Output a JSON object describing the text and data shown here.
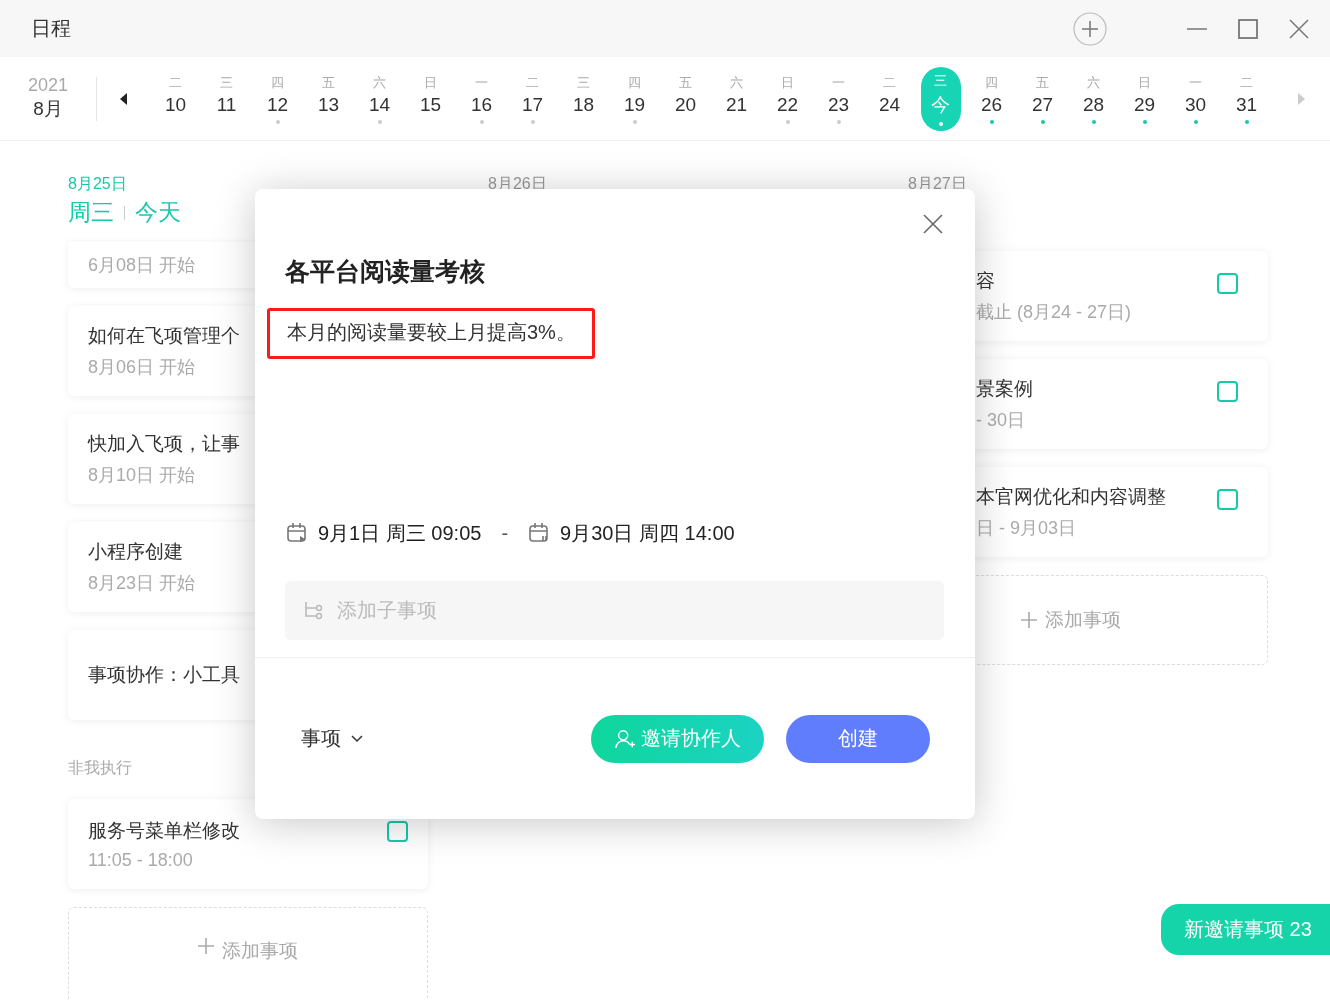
{
  "window": {
    "title": "日程"
  },
  "strip": {
    "year": "2021",
    "month": "8月",
    "days": [
      {
        "weekday": "二",
        "date": "10",
        "selected": false
      },
      {
        "weekday": "三",
        "date": "11",
        "selected": false
      },
      {
        "weekday": "四",
        "date": "12",
        "selected": false,
        "color": "#cccccc"
      },
      {
        "weekday": "五",
        "date": "13",
        "selected": false
      },
      {
        "weekday": "六",
        "date": "14",
        "selected": false,
        "color": "#cccccc"
      },
      {
        "weekday": "日",
        "date": "15",
        "selected": false
      },
      {
        "weekday": "一",
        "date": "16",
        "selected": false,
        "color": "#cccccc"
      },
      {
        "weekday": "二",
        "date": "17",
        "selected": false,
        "color": "#cccccc"
      },
      {
        "weekday": "三",
        "date": "18",
        "selected": false
      },
      {
        "weekday": "四",
        "date": "19",
        "selected": false,
        "color": "#cccccc"
      },
      {
        "weekday": "五",
        "date": "20",
        "selected": false
      },
      {
        "weekday": "六",
        "date": "21",
        "selected": false
      },
      {
        "weekday": "日",
        "date": "22",
        "selected": false,
        "color": "#cccccc"
      },
      {
        "weekday": "一",
        "date": "23",
        "selected": false,
        "color": "#cccccc"
      },
      {
        "weekday": "二",
        "date": "24",
        "selected": false
      },
      {
        "weekday": "三",
        "date": "今",
        "selected": true,
        "color": "#ffffff"
      },
      {
        "weekday": "四",
        "date": "26",
        "selected": false,
        "color": "#16c9ab"
      },
      {
        "weekday": "五",
        "date": "27",
        "selected": false,
        "color": "#16c9ab"
      },
      {
        "weekday": "六",
        "date": "28",
        "selected": false,
        "color": "#16c9ab"
      },
      {
        "weekday": "日",
        "date": "29",
        "selected": false,
        "color": "#16c9ab"
      },
      {
        "weekday": "一",
        "date": "30",
        "selected": false,
        "color": "#16c9ab"
      },
      {
        "weekday": "二",
        "date": "31",
        "selected": false,
        "color": "#16c9ab"
      }
    ]
  },
  "columns": [
    {
      "date": "8月25日",
      "weekday": "周三",
      "today": "今天",
      "tasks": [
        {
          "subtitle": "6月08日 开始"
        },
        {
          "title": "如何在飞项管理个",
          "subtitle": "8月06日 开始"
        },
        {
          "title": "快加入飞项，让事",
          "subtitle": "8月10日 开始"
        },
        {
          "title": "小程序创建",
          "subtitle": "8月23日 开始"
        },
        {
          "title": "事项协作：小工具"
        }
      ],
      "section": "非我执行",
      "other_tasks": [
        {
          "title": "服务号菜单栏修改",
          "subtitle": "11:05 - 18:00",
          "checked": false
        }
      ],
      "add": "添加事项"
    },
    {
      "date": "8月26日"
    },
    {
      "date": "8月27日",
      "tasks": [
        {
          "title": "容",
          "subtitle": "截止 (8月24 - 27日)",
          "checked": false
        },
        {
          "title": "景案例",
          "subtitle": "- 30日",
          "checked": false
        },
        {
          "title": "本官网优化和内容调整",
          "subtitle": "日 - 9月03日",
          "checked": false
        }
      ],
      "add": "添加事项"
    }
  ],
  "dialog": {
    "title": "各平台阅读量考核",
    "description": "本月的阅读量要较上月提高3%。",
    "highlighted": true,
    "start": "9月1日 周三 09:05",
    "separator": "-",
    "end": "9月30日 周四 14:00",
    "subtask_placeholder": "添加子事项",
    "type": "事项",
    "invite": "邀请协作人",
    "create": "创建"
  },
  "invites_button": "新邀请事项 23"
}
